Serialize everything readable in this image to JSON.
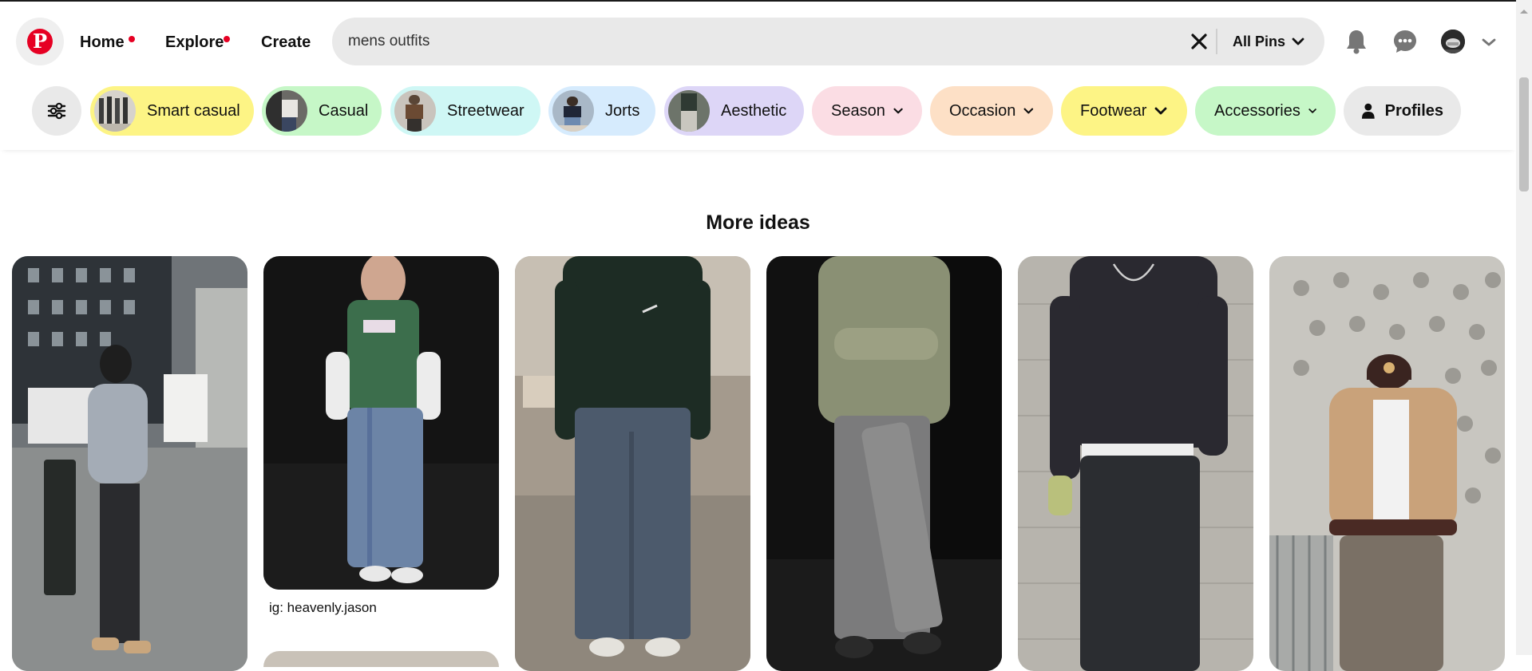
{
  "header": {
    "logo": "pinterest-logo",
    "nav": [
      {
        "label": "Home",
        "has_dot": true
      },
      {
        "label": "Explore",
        "has_dot": true
      },
      {
        "label": "Create",
        "has_dot": false
      }
    ],
    "search": {
      "value": "mens outfits",
      "placeholder": "Search",
      "scope_label": "All Pins"
    },
    "icons": [
      "notification-bell-icon",
      "messages-icon",
      "user-avatar",
      "account-chevron-icon"
    ]
  },
  "filters": {
    "pills": [
      {
        "label": "Smart casual",
        "bg": "#fdf485",
        "has_image": true
      },
      {
        "label": "Casual",
        "bg": "#c6f7c7",
        "has_image": true
      },
      {
        "label": "Streetwear",
        "bg": "#cff7f5",
        "has_image": true
      },
      {
        "label": "Jorts",
        "bg": "#d6ebfd",
        "has_image": true
      },
      {
        "label": "Aesthetic",
        "bg": "#ddd6f7",
        "has_image": true
      },
      {
        "label": "Season",
        "bg": "#fbdde4",
        "dropdown": true
      },
      {
        "label": "Occasion",
        "bg": "#fde0c6",
        "dropdown": true
      },
      {
        "label": "Footwear",
        "bg": "#fdf485",
        "dropdown": true
      },
      {
        "label": "Accessories",
        "bg": "#c6f7c7",
        "dropdown": true
      },
      {
        "label": "Profiles",
        "bg": "#e9e9e9",
        "bold": true
      }
    ]
  },
  "content": {
    "section_title": "More ideas",
    "pins": [
      {
        "name": "pin-grey-hoodie-city-street",
        "caption": ""
      },
      {
        "name": "pin-green-tee-baggy-jeans",
        "caption": "ig: heavenly.jason"
      },
      {
        "name": "pin-dark-green-sweater-jeans",
        "caption": ""
      },
      {
        "name": "pin-sage-knit-sweater-grey-jeans",
        "caption": ""
      },
      {
        "name": "pin-charcoal-sweatshirt-black-jeans",
        "caption": ""
      },
      {
        "name": "pin-tan-jacket-padres-cap",
        "caption": ""
      }
    ]
  },
  "colors": {
    "brand_red": "#e60023",
    "search_bg": "#e9e9e9"
  }
}
